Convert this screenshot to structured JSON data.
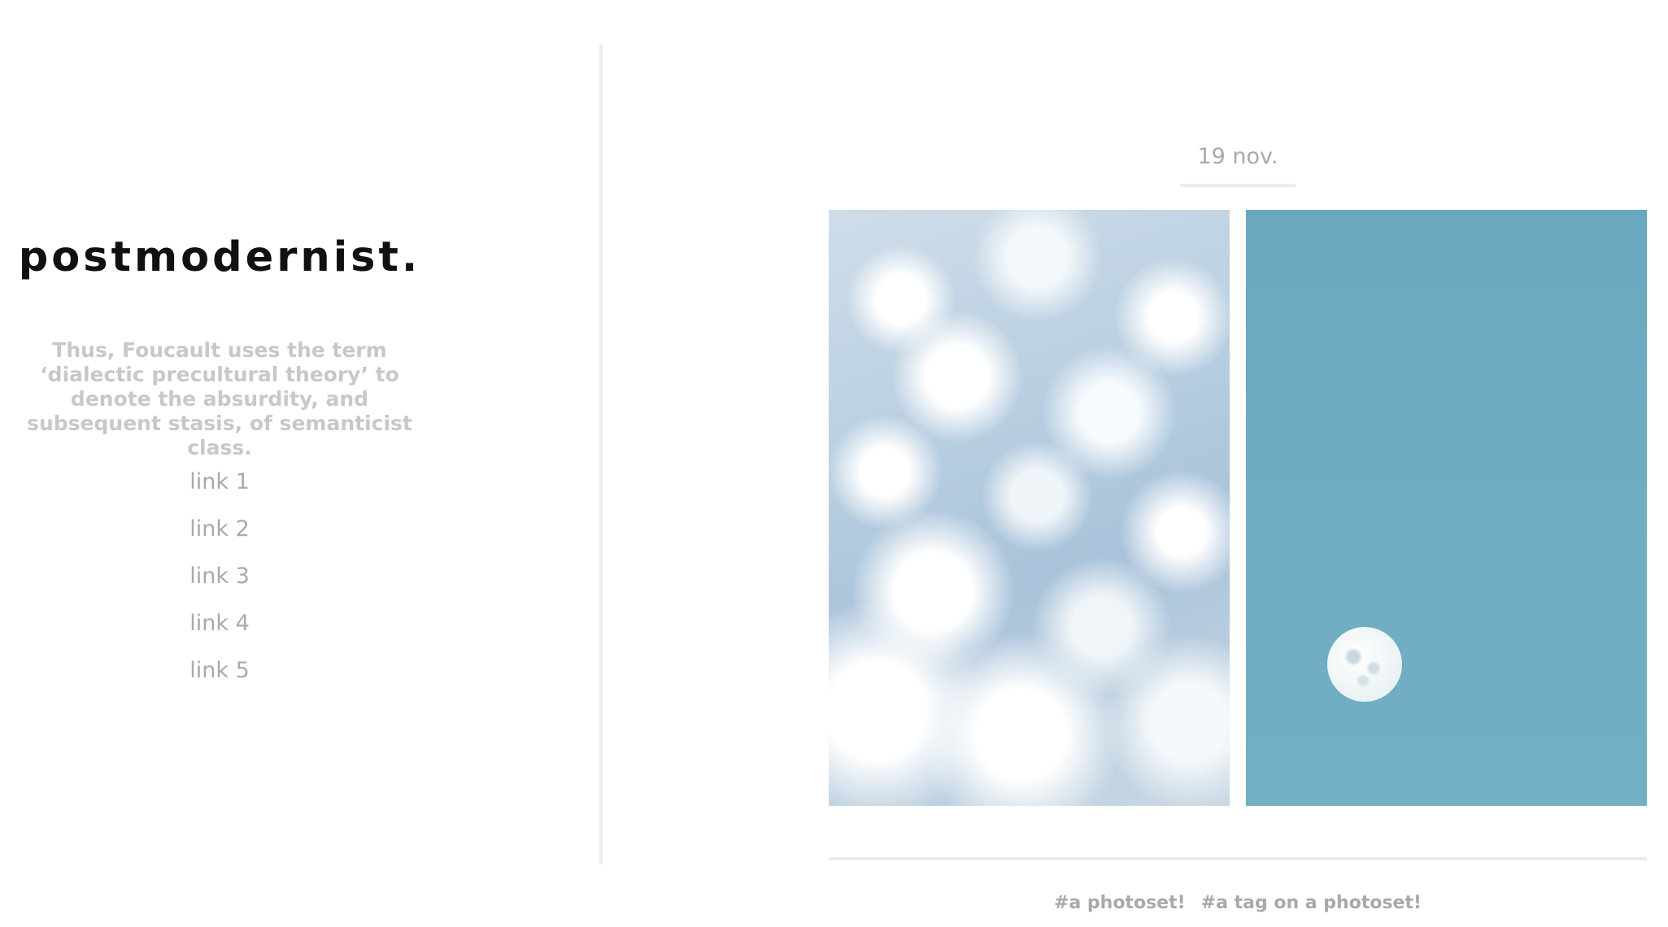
{
  "sidebar": {
    "title": "postmodernist.",
    "description": "Thus, Foucault uses the term ‘dialectic precultural theory’ to denote the absurdity, and subsequent stasis, of semanticist class.",
    "links": [
      {
        "label": "link 1"
      },
      {
        "label": "link 2"
      },
      {
        "label": "link 3"
      },
      {
        "label": "link 4"
      },
      {
        "label": "link 5"
      }
    ]
  },
  "post": {
    "date": "19 nov.",
    "photos": [
      {
        "subject": "clouds"
      },
      {
        "subject": "moon in blue sky"
      }
    ],
    "tags": [
      "#a photoset!",
      "#a tag on a photoset!"
    ]
  }
}
